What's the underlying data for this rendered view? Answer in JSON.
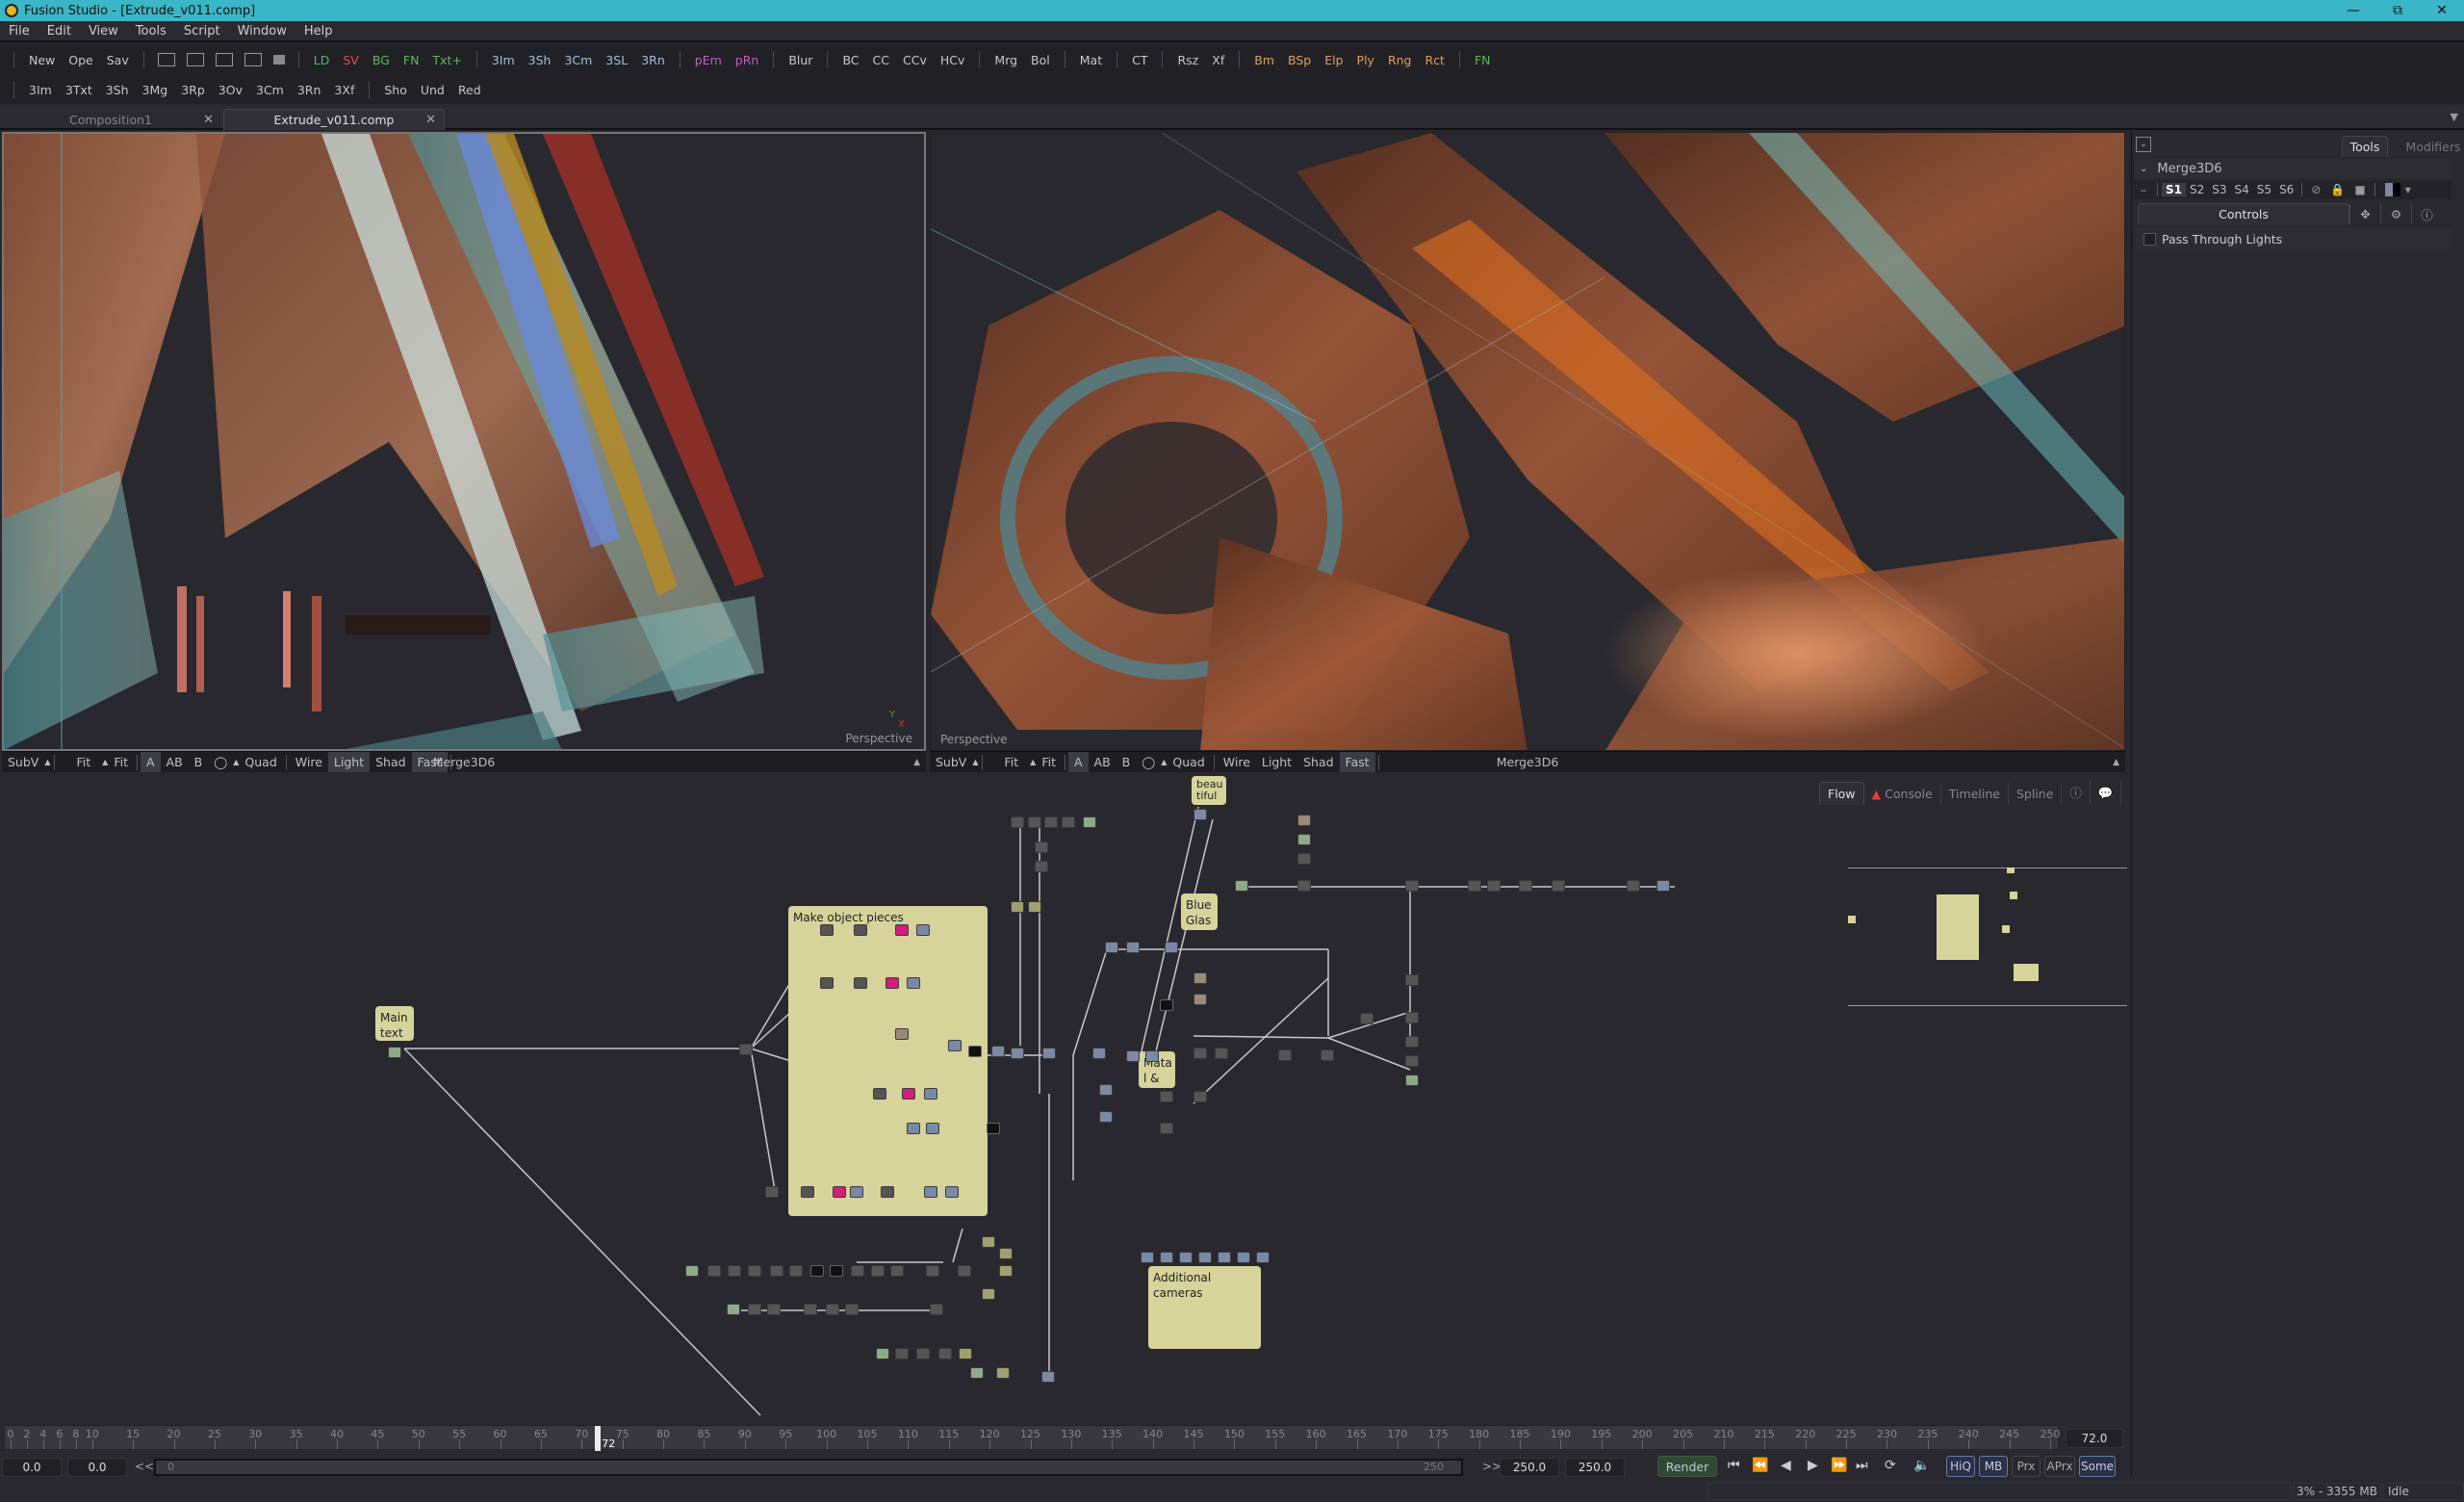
{
  "window": {
    "title": "Fusion Studio - [Extrude_v011.comp]",
    "controls": [
      "minimize",
      "restore",
      "close"
    ]
  },
  "menu": [
    "File",
    "Edit",
    "View",
    "Tools",
    "Script",
    "Window",
    "Help"
  ],
  "toolbar1": {
    "file": [
      "New",
      "Ope",
      "Sav"
    ],
    "tools": [
      {
        "label": "LD",
        "color": "green"
      },
      {
        "label": "SV",
        "color": "red"
      },
      {
        "label": "BG",
        "color": "green"
      },
      {
        "label": "FN",
        "color": "green"
      },
      {
        "label": "Txt+",
        "color": "green"
      },
      {
        "label": "3Im",
        "color": "cyan"
      },
      {
        "label": "3Sh",
        "color": "cyan"
      },
      {
        "label": "3Cm",
        "color": "cyan"
      },
      {
        "label": "3SL",
        "color": "cyan"
      },
      {
        "label": "3Rn",
        "color": "cyan"
      },
      {
        "label": "pEm",
        "color": "pink"
      },
      {
        "label": "pRn",
        "color": "pink"
      },
      {
        "label": "Blur",
        "color": "default"
      },
      {
        "label": "BC",
        "color": "default"
      },
      {
        "label": "CC",
        "color": "default"
      },
      {
        "label": "CCv",
        "color": "default"
      },
      {
        "label": "HCv",
        "color": "default"
      },
      {
        "label": "Mrg",
        "color": "default"
      },
      {
        "label": "Bol",
        "color": "default"
      },
      {
        "label": "Mat",
        "color": "default"
      },
      {
        "label": "CT",
        "color": "default"
      },
      {
        "label": "Rsz",
        "color": "default"
      },
      {
        "label": "Xf",
        "color": "default"
      },
      {
        "label": "Bm",
        "color": "orange"
      },
      {
        "label": "BSp",
        "color": "orange"
      },
      {
        "label": "Elp",
        "color": "orange"
      },
      {
        "label": "Ply",
        "color": "orange"
      },
      {
        "label": "Rng",
        "color": "orange"
      },
      {
        "label": "Rct",
        "color": "orange"
      },
      {
        "label": "FN",
        "color": "green"
      }
    ]
  },
  "toolbar2": {
    "tools": [
      "3Im",
      "3Txt",
      "3Sh",
      "3Mg",
      "3Rp",
      "3Ov",
      "3Cm",
      "3Rn",
      "3Xf"
    ],
    "edit": [
      "Sho",
      "Und",
      "Red"
    ]
  },
  "tabs": [
    {
      "label": "Composition1",
      "active": false
    },
    {
      "label": "Extrude_v011.comp",
      "active": true
    }
  ],
  "viewers": [
    {
      "camera_label": "Perspective",
      "toolbar": {
        "subv": "SubV",
        "fit1": "Fit",
        "fit2": "Fit",
        "a": "A",
        "ab": "AB",
        "b": "B",
        "quad": "Quad",
        "wire": "Wire",
        "light": "Light",
        "shad": "Shad",
        "fast": "Fast",
        "title": "Merge3D6"
      },
      "active": true
    },
    {
      "camera_label": "Perspective",
      "toolbar": {
        "subv": "SubV",
        "fit1": "Fit",
        "fit2": "Fit",
        "a": "A",
        "ab": "AB",
        "b": "B",
        "quad": "Quad",
        "wire": "Wire",
        "light": "Light",
        "shad": "Shad",
        "fast": "Fast",
        "title": "Merge3D6"
      },
      "active": false
    }
  ],
  "inspector": {
    "tabs": [
      "Tools",
      "Modifiers"
    ],
    "node_name": "Merge3D6",
    "slots": [
      "S1",
      "S2",
      "S3",
      "S4",
      "S5",
      "S6"
    ],
    "active_slot": "S1",
    "control_tab": "Controls",
    "options": [
      {
        "label": "Pass Through Lights",
        "checked": false
      }
    ]
  },
  "flow": {
    "tabs": [
      "Flow",
      "Console",
      "Timeline",
      "Spline"
    ],
    "active_tab": "Flow",
    "notes": {
      "main_text": "Main\ntext",
      "make_object_pieces": "Make object pieces",
      "beautiful": "beau\ntiful",
      "blue_glass": "Blue\nGlas",
      "material": "Mata\nl &",
      "additional_cameras": "Additional cameras"
    }
  },
  "timeline": {
    "ticks": [
      0,
      2,
      4,
      6,
      8,
      10,
      15,
      20,
      25,
      30,
      35,
      40,
      45,
      50,
      55,
      60,
      65,
      70,
      75,
      80,
      85,
      90,
      95,
      100,
      105,
      110,
      115,
      120,
      125,
      130,
      135,
      140,
      145,
      150,
      155,
      160,
      165,
      170,
      175,
      180,
      185,
      190,
      195,
      200,
      205,
      210,
      215,
      220,
      225,
      230,
      235,
      240,
      245,
      250
    ],
    "current_frame": 72,
    "current_frame_display": "72.0",
    "global_start": "0.0",
    "render_start": "0.0",
    "render_end": "250.0",
    "global_end": "250.0",
    "range_start_label": "0",
    "range_end_label": "250",
    "render_label": "Render",
    "quality_buttons": [
      {
        "label": "HiQ",
        "on": true
      },
      {
        "label": "MB",
        "on": true
      },
      {
        "label": "Prx",
        "on": false
      },
      {
        "label": "APrx",
        "on": false
      },
      {
        "label": "Some",
        "on": true
      }
    ]
  },
  "status": {
    "memory": "3% - 3355 MB",
    "state": "Idle"
  }
}
